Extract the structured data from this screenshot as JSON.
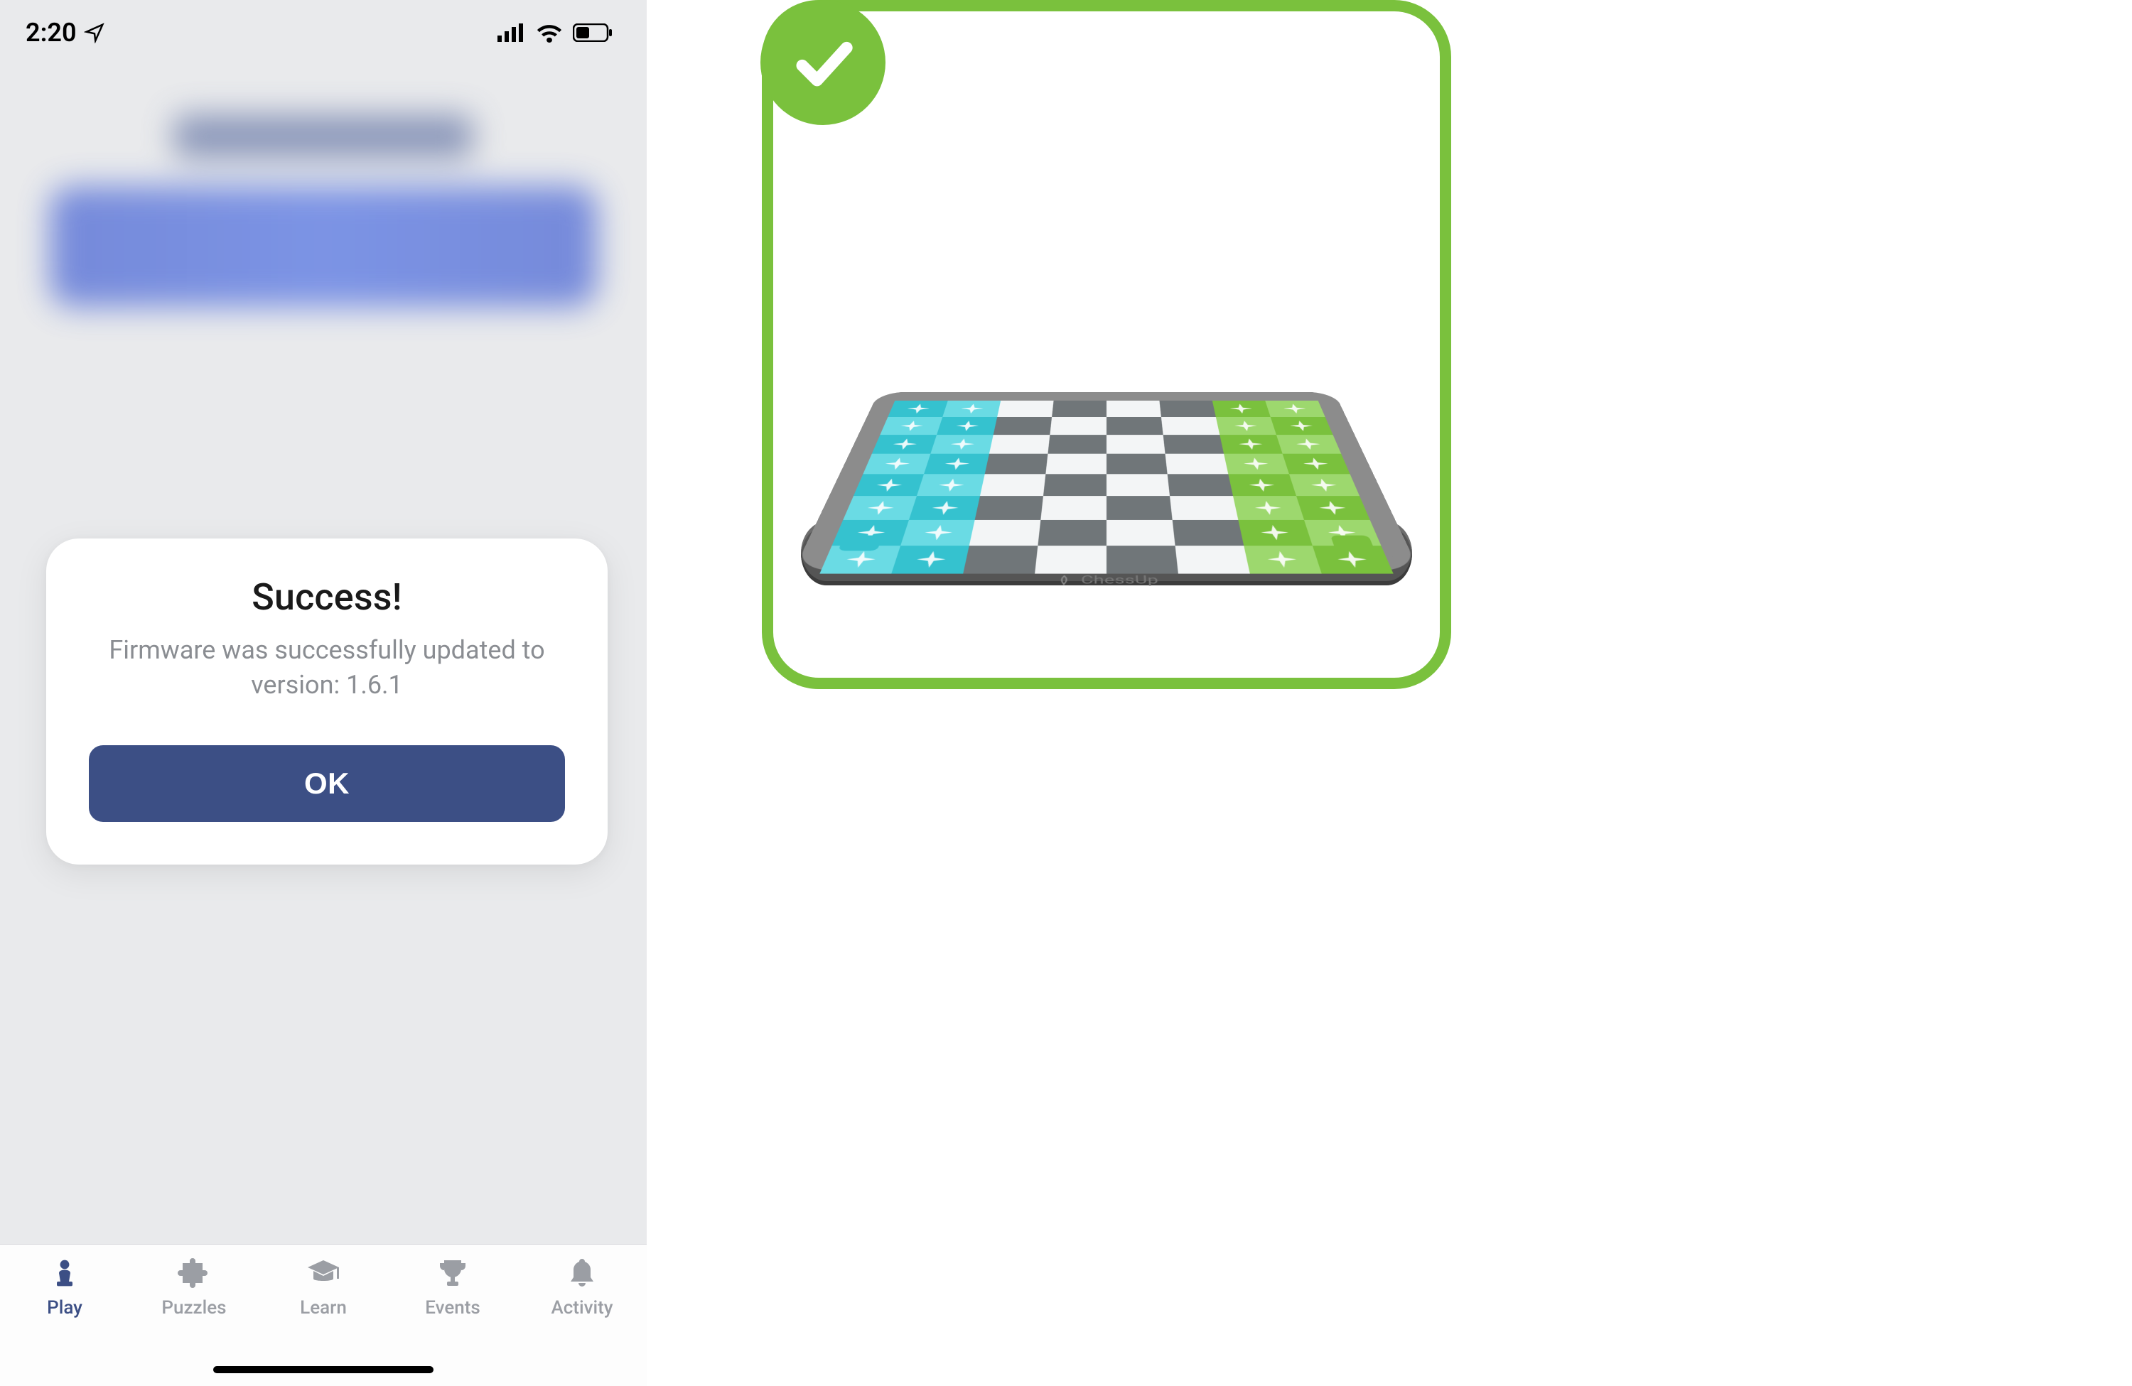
{
  "statusbar": {
    "time": "2:20"
  },
  "dialog": {
    "title": "Success!",
    "line1": "Firmware was successfully updated to",
    "line2": "version: 1.6.1",
    "ok_label": "OK"
  },
  "tabs": {
    "play": "Play",
    "puzzles": "Puzzles",
    "learn": "Learn",
    "events": "Events",
    "activity": "Activity"
  },
  "board": {
    "brand": "ChessUp"
  }
}
